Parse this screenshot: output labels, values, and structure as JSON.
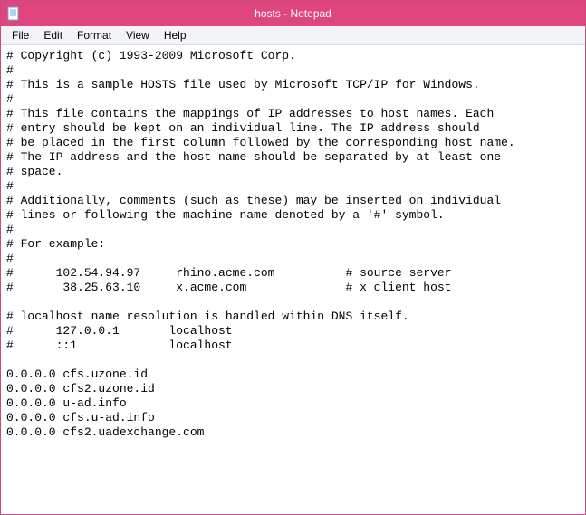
{
  "titlebar": {
    "title": "hosts - Notepad",
    "icon": "notepad-icon"
  },
  "menubar": {
    "items": [
      {
        "label": "File"
      },
      {
        "label": "Edit"
      },
      {
        "label": "Format"
      },
      {
        "label": "View"
      },
      {
        "label": "Help"
      }
    ]
  },
  "editor": {
    "content": "# Copyright (c) 1993-2009 Microsoft Corp.\n#\n# This is a sample HOSTS file used by Microsoft TCP/IP for Windows.\n#\n# This file contains the mappings of IP addresses to host names. Each\n# entry should be kept on an individual line. The IP address should\n# be placed in the first column followed by the corresponding host name.\n# The IP address and the host name should be separated by at least one\n# space.\n#\n# Additionally, comments (such as these) may be inserted on individual\n# lines or following the machine name denoted by a '#' symbol.\n#\n# For example:\n#\n#      102.54.94.97     rhino.acme.com          # source server\n#       38.25.63.10     x.acme.com              # x client host\n\n# localhost name resolution is handled within DNS itself.\n#      127.0.0.1       localhost\n#      ::1             localhost\n\n0.0.0.0 cfs.uzone.id\n0.0.0.0 cfs2.uzone.id\n0.0.0.0 u-ad.info\n0.0.0.0 cfs.u-ad.info\n0.0.0.0 cfs2.uadexchange.com"
  }
}
